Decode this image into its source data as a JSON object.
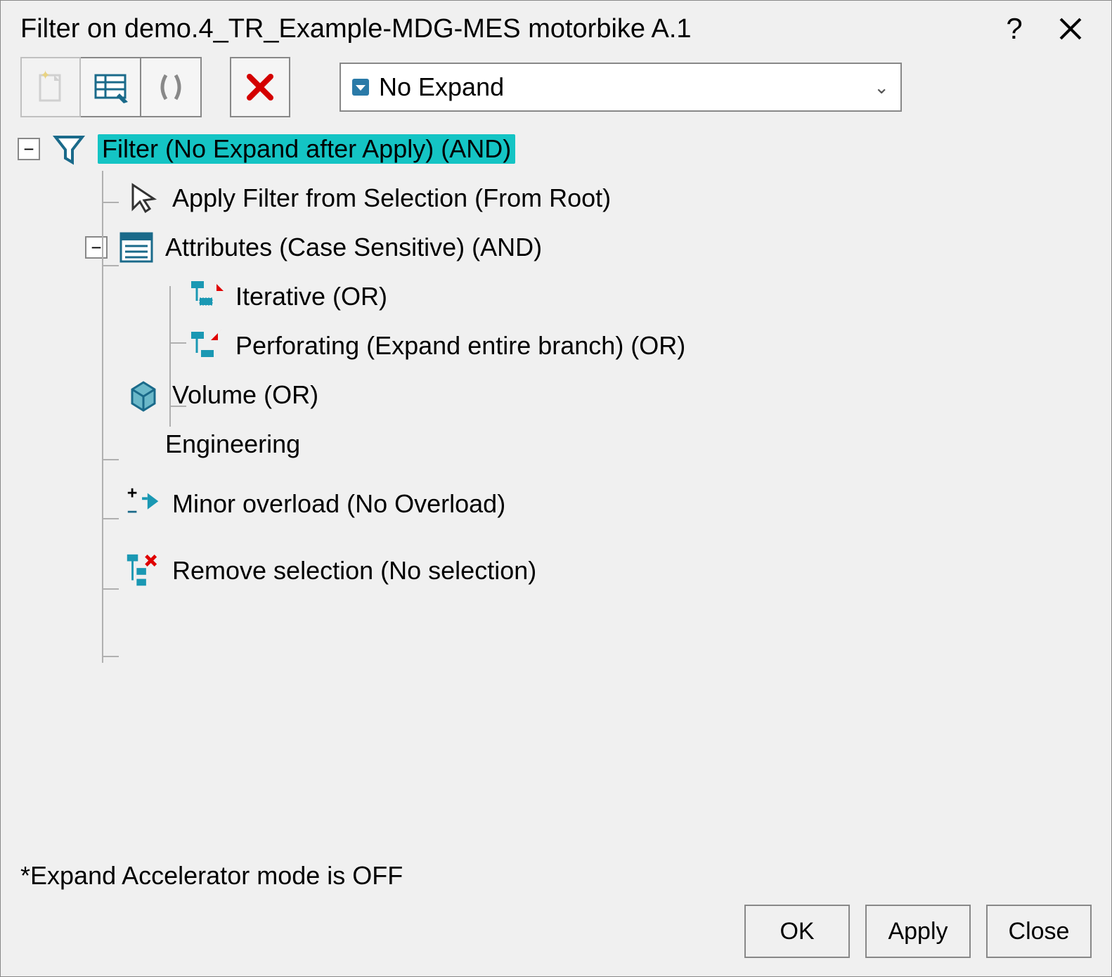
{
  "title": "Filter on demo.4_TR_Example-MDG-MES motorbike A.1",
  "titlebar": {
    "help": "?",
    "close": "×"
  },
  "toolbar": {
    "combo_selected": "No Expand"
  },
  "tree": {
    "root": "Filter (No Expand after Apply) (AND)",
    "apply_from_selection": "Apply Filter from Selection (From Root)",
    "attributes": "Attributes (Case Sensitive) (AND)",
    "iterative": "Iterative (OR)",
    "perforating": "Perforating (Expand entire branch) (OR)",
    "volume": "Volume (OR)",
    "engineering": "Engineering",
    "minor_overload": "Minor overload (No Overload)",
    "remove_selection": "Remove selection (No selection)"
  },
  "footer_note": "*Expand Accelerator mode is OFF",
  "buttons": {
    "ok": "OK",
    "apply": "Apply",
    "close": "Close"
  }
}
